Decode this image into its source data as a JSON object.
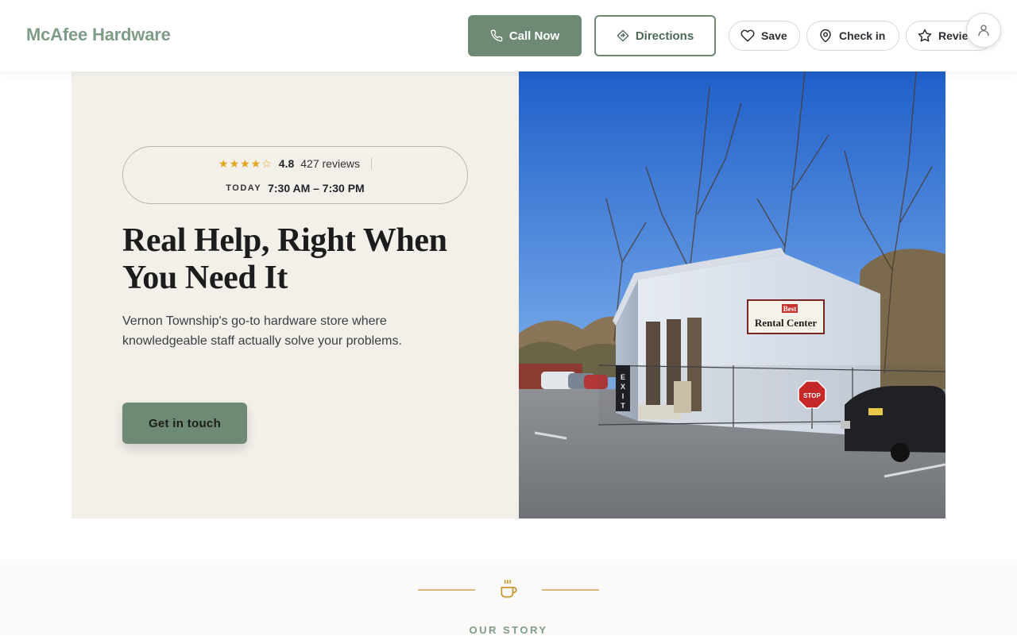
{
  "header": {
    "brand": "McAfee Hardware",
    "call_label": "Call Now",
    "directions_label": "Directions",
    "save_label": "Save",
    "checkin_label": "Check in",
    "review_label": "Review"
  },
  "hero": {
    "rating": "4.8",
    "rating_stars": 4.5,
    "reviews": "427 reviews",
    "today_label": "TODAY",
    "hours": "7:30 AM – 7:30 PM",
    "headline": "Real Help, Right When You Need It",
    "subtext": "Vernon Township's go-to hardware store where knowledgeable staff actually solve your problems.",
    "cta_label": "Get in touch",
    "image_sign_line1": "Best",
    "image_sign_line2": "Rental Center",
    "image_stop": "STOP"
  },
  "story": {
    "label": "OUR STORY"
  },
  "colors": {
    "brand_green": "#7f9c86",
    "button_green": "#6f8a74",
    "hero_bg": "#f3f0ea",
    "star_gold": "#e3a21a",
    "accent_gold": "#d9b97a"
  },
  "icons": {
    "call": "phone-icon",
    "directions": "directions-icon",
    "save": "heart-icon",
    "checkin": "map-pin-icon",
    "review": "star-icon",
    "account": "user-icon",
    "story": "coffee-cup-icon"
  }
}
